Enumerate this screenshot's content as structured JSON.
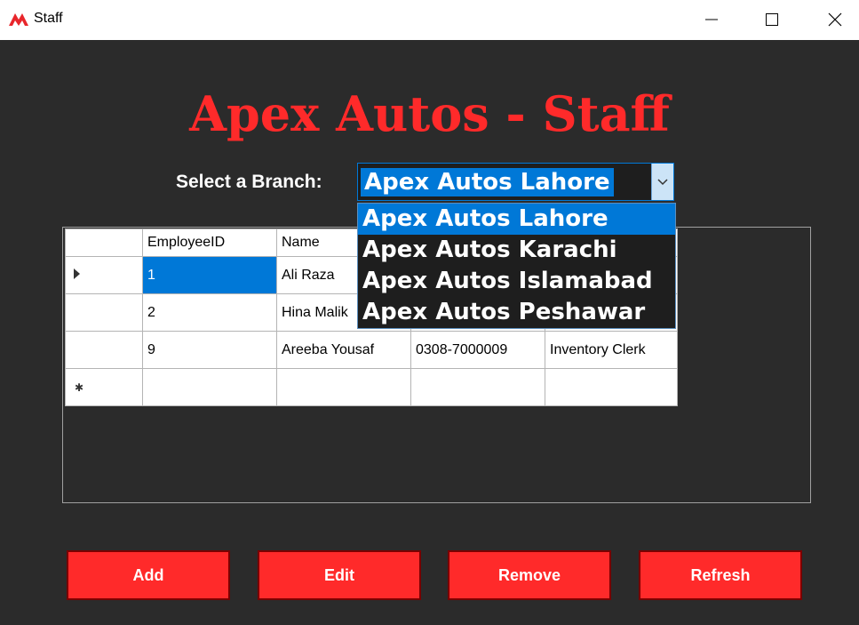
{
  "window": {
    "title": "Staff",
    "icon": "apex-logo-icon"
  },
  "header": {
    "title": "Apex Autos - Staff",
    "accent_color": "#ff2a2a"
  },
  "branch_select": {
    "label": "Select a Branch:",
    "selected": "Apex Autos Lahore",
    "options": [
      "Apex Autos Lahore",
      "Apex Autos Karachi",
      "Apex Autos Islamabad",
      "Apex Autos Peshawar"
    ]
  },
  "grid": {
    "columns": [
      "EmployeeID",
      "Name",
      "",
      ""
    ],
    "rows": [
      [
        "1",
        "Ali Raza",
        "",
        ""
      ],
      [
        "2",
        "Hina Malik",
        "",
        ""
      ],
      [
        "9",
        "Areeba Yousaf",
        "0308-7000009",
        "Inventory Clerk"
      ]
    ],
    "current_row_index": 0,
    "selected_color": "#0078d7"
  },
  "buttons": {
    "add": "Add",
    "edit": "Edit",
    "remove": "Remove",
    "refresh": "Refresh"
  }
}
